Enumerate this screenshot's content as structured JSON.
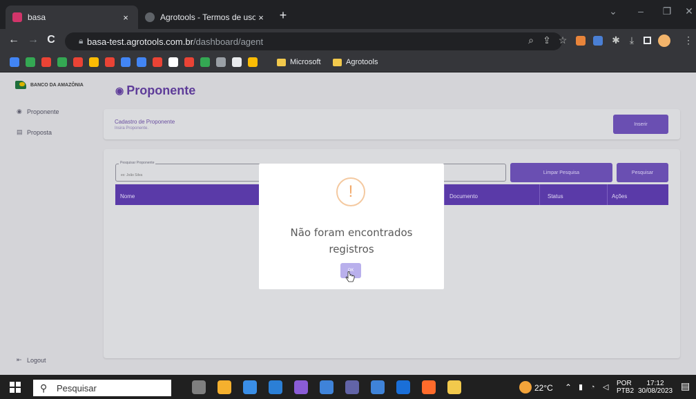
{
  "browser": {
    "tabs": [
      {
        "title": "basa",
        "close": "×",
        "active": true,
        "favicon_color": "#d1356a"
      },
      {
        "title": "Agrotools - Termos de uso",
        "close": "×",
        "active": false,
        "favicon_color": "#9aa0a6"
      }
    ],
    "new_tab": "+",
    "window_controls": [
      "⌄",
      "–",
      "❐",
      "✕"
    ],
    "nav": {
      "back": "←",
      "forward": "→",
      "reload": "C"
    },
    "url_host": "basa-test.agrotools.com.br",
    "url_path": "/dashboard/agent",
    "toolbar_icons": [
      "zoom-icon",
      "share-icon",
      "star-icon",
      "extension-icon",
      "extension-icon",
      "puzzle-icon",
      "download-icon",
      "sidepanel-icon",
      "profile-icon",
      "menu-icon"
    ],
    "bookmarks": {
      "icon_colors": [
        "#4285f4",
        "#34a853",
        "#ea4335",
        "#34a853",
        "#ea4335",
        "#fbbc04",
        "#ea4335",
        "#4285f4",
        "#4285f4",
        "#ea4335",
        "#ffffff",
        "#ea4335",
        "#34a853",
        "#9aa0a6",
        "#e8eaed",
        "#fbbc04"
      ],
      "folders": [
        "Microsoft",
        "Agrotools"
      ]
    }
  },
  "app": {
    "logo": "BANCO DA AMAZÔNIA",
    "sidebar": [
      {
        "label": "Proponente",
        "icon": "◉"
      },
      {
        "label": "Proposta",
        "icon": "▤"
      }
    ],
    "logout": "Logout",
    "logout_icon": "⇤",
    "page_title": "Proponente",
    "page_title_icon": "◉",
    "register_card": {
      "heading": "Cadastro de Proponente",
      "subtext": "Insira Proponente.",
      "insert_button": "Inserir"
    },
    "search": {
      "label": "Pesquisar Proponente",
      "placeholder": "ex: João Silva",
      "clear_button": "Limpar Pesquisa",
      "search_button": "Pesquisar"
    },
    "table_headers": [
      "Nome",
      "Documento",
      "Status",
      "Ações"
    ]
  },
  "modal": {
    "icon": "!",
    "message_line1": "Não foram encontrados",
    "message_line2": "registros",
    "ok_button": "OK"
  },
  "taskbar": {
    "search_placeholder": "Pesquisar",
    "weather": "22°C",
    "language_line1": "POR",
    "language_line2": "PTB2",
    "time": "17:12",
    "date": "30/08/2023",
    "app_colors": [
      "#7f7f7f",
      "#f5b02e",
      "#3a8ee6",
      "#2b7fd6",
      "#8a5cd6",
      "#3f83d9",
      "#6264a7",
      "#3f83d9",
      "#1a6fd8",
      "#ff6b2b",
      "#f2c94c"
    ]
  }
}
